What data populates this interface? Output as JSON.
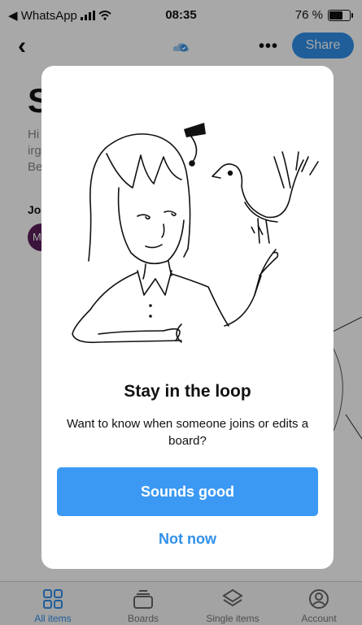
{
  "status_bar": {
    "back_app": "◀ WhatsApp",
    "time": "08:35",
    "battery_percent": "76 %",
    "battery_level": 0.76
  },
  "header": {
    "back_glyph": "‹",
    "more_glyph": "•••",
    "share_label": "Share",
    "cloud_icon": "cloud-check-icon"
  },
  "page": {
    "title_fragment": "S",
    "desc_lines": [
      "Hi",
      "irg",
      "Be"
    ],
    "join_label": "Joi",
    "avatar_initial": "M"
  },
  "modal": {
    "title": "Stay in the loop",
    "subtitle": "Want to know when someone joins or edits a board?",
    "primary_button": "Sounds good",
    "secondary_button": "Not now",
    "illustration": "girl-with-bird-illustration"
  },
  "tabs": [
    {
      "label": "All items",
      "icon": "grid-icon",
      "active": true
    },
    {
      "label": "Boards",
      "icon": "board-stack-icon",
      "active": false
    },
    {
      "label": "Single items",
      "icon": "layers-icon",
      "active": false
    },
    {
      "label": "Account",
      "icon": "account-icon",
      "active": false
    }
  ],
  "colors": {
    "accent": "#2f8fe8",
    "primary_button": "#3b99f4",
    "overlay": "rgba(0,0,0,0.34)"
  }
}
